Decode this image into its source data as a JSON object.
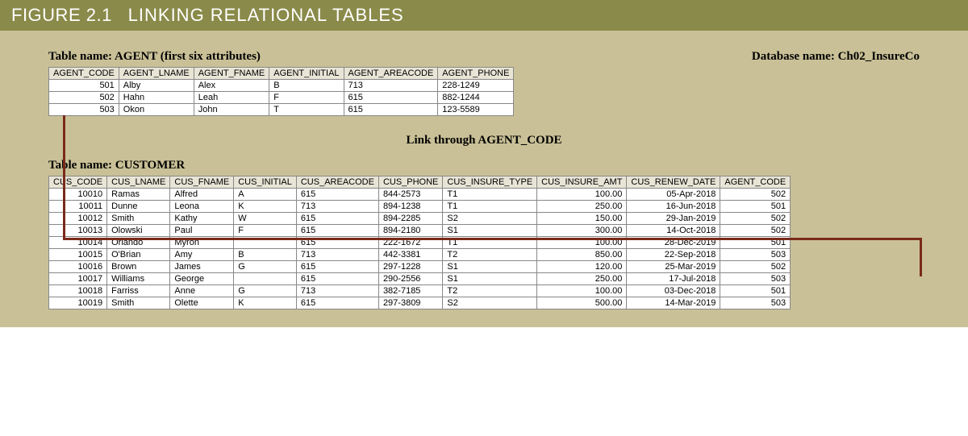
{
  "figure": {
    "number": "FIGURE 2.1",
    "title": "LINKING RELATIONAL TABLES"
  },
  "database_label": "Database name: Ch02_InsureCo",
  "agent_table": {
    "label": "Table name: AGENT (first six attributes)",
    "headers": [
      "AGENT_CODE",
      "AGENT_LNAME",
      "AGENT_FNAME",
      "AGENT_INITIAL",
      "AGENT_AREACODE",
      "AGENT_PHONE"
    ],
    "rows": [
      {
        "code": "501",
        "lname": "Alby",
        "fname": "Alex",
        "initial": "B",
        "area": "713",
        "phone": "228-1249"
      },
      {
        "code": "502",
        "lname": "Hahn",
        "fname": "Leah",
        "initial": "F",
        "area": "615",
        "phone": "882-1244"
      },
      {
        "code": "503",
        "lname": "Okon",
        "fname": "John",
        "initial": "T",
        "area": "615",
        "phone": "123-5589"
      }
    ]
  },
  "link_caption": "Link through AGENT_CODE",
  "customer_table": {
    "label": "Table name: CUSTOMER",
    "headers": [
      "CUS_CODE",
      "CUS_LNAME",
      "CUS_FNAME",
      "CUS_INITIAL",
      "CUS_AREACODE",
      "CUS_PHONE",
      "CUS_INSURE_TYPE",
      "CUS_INSURE_AMT",
      "CUS_RENEW_DATE",
      "AGENT_CODE"
    ],
    "rows": [
      {
        "code": "10010",
        "lname": "Ramas",
        "fname": "Alfred",
        "initial": "A",
        "area": "615",
        "phone": "844-2573",
        "type": "T1",
        "amt": "100.00",
        "renew": "05-Apr-2018",
        "agent": "502"
      },
      {
        "code": "10011",
        "lname": "Dunne",
        "fname": "Leona",
        "initial": "K",
        "area": "713",
        "phone": "894-1238",
        "type": "T1",
        "amt": "250.00",
        "renew": "16-Jun-2018",
        "agent": "501"
      },
      {
        "code": "10012",
        "lname": "Smith",
        "fname": "Kathy",
        "initial": "W",
        "area": "615",
        "phone": "894-2285",
        "type": "S2",
        "amt": "150.00",
        "renew": "29-Jan-2019",
        "agent": "502"
      },
      {
        "code": "10013",
        "lname": "Olowski",
        "fname": "Paul",
        "initial": "F",
        "area": "615",
        "phone": "894-2180",
        "type": "S1",
        "amt": "300.00",
        "renew": "14-Oct-2018",
        "agent": "502"
      },
      {
        "code": "10014",
        "lname": "Orlando",
        "fname": "Myron",
        "initial": "",
        "area": "615",
        "phone": "222-1672",
        "type": "T1",
        "amt": "100.00",
        "renew": "28-Dec-2019",
        "agent": "501"
      },
      {
        "code": "10015",
        "lname": "O'Brian",
        "fname": "Amy",
        "initial": "B",
        "area": "713",
        "phone": "442-3381",
        "type": "T2",
        "amt": "850.00",
        "renew": "22-Sep-2018",
        "agent": "503"
      },
      {
        "code": "10016",
        "lname": "Brown",
        "fname": "James",
        "initial": "G",
        "area": "615",
        "phone": "297-1228",
        "type": "S1",
        "amt": "120.00",
        "renew": "25-Mar-2019",
        "agent": "502"
      },
      {
        "code": "10017",
        "lname": "Williams",
        "fname": "George",
        "initial": "",
        "area": "615",
        "phone": "290-2556",
        "type": "S1",
        "amt": "250.00",
        "renew": "17-Jul-2018",
        "agent": "503"
      },
      {
        "code": "10018",
        "lname": "Farriss",
        "fname": "Anne",
        "initial": "G",
        "area": "713",
        "phone": "382-7185",
        "type": "T2",
        "amt": "100.00",
        "renew": "03-Dec-2018",
        "agent": "501"
      },
      {
        "code": "10019",
        "lname": "Smith",
        "fname": "Olette",
        "initial": "K",
        "area": "615",
        "phone": "297-3809",
        "type": "S2",
        "amt": "500.00",
        "renew": "14-Mar-2019",
        "agent": "503"
      }
    ]
  }
}
